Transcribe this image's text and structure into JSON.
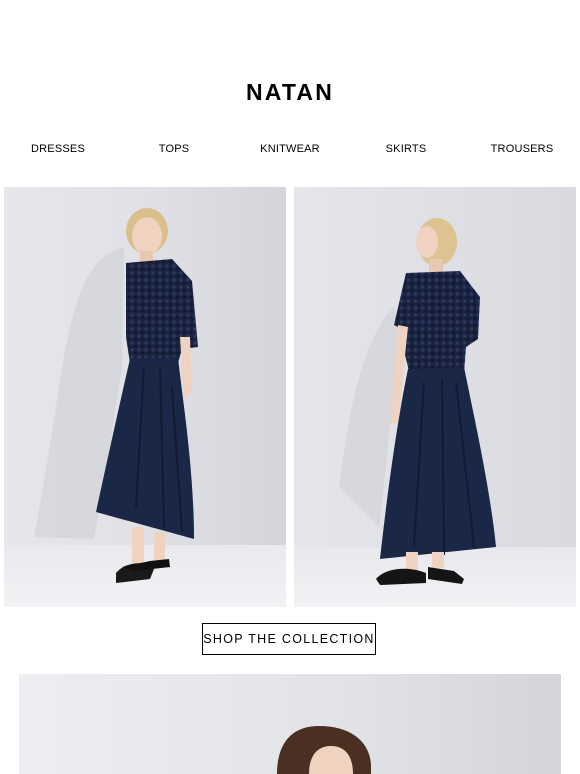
{
  "brand": {
    "logo_text": "NATAN"
  },
  "nav": {
    "items": [
      {
        "label": "DRESSES"
      },
      {
        "label": "TOPS"
      },
      {
        "label": "KNITWEAR"
      },
      {
        "label": "SKIRTS"
      },
      {
        "label": "TROUSERS"
      }
    ]
  },
  "hero": {
    "cta_label": "SHOP THE COLLECTION"
  },
  "colors": {
    "navy": "#1b2746",
    "backdrop": "#dcdde2",
    "text": "#000000"
  }
}
